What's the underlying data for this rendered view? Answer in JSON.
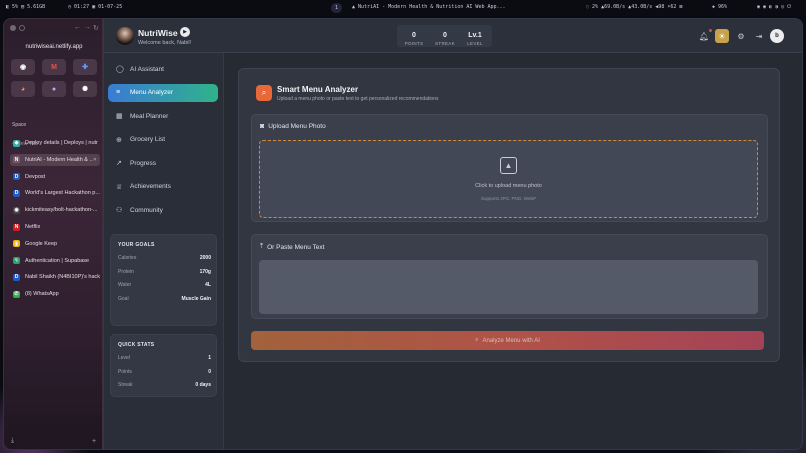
{
  "sysbar": {
    "left_a": "5%",
    "left_b": "5.61GB",
    "clock": "01:27",
    "date": "01-07-25",
    "workspace": "1",
    "window_title": "NutriAI - Modern Health & Nutrition AI Web App...",
    "cpu": "2%",
    "net_down": "69.0B/s",
    "net_up": "43.0B/s",
    "vol": "98",
    "bright": "62",
    "battery": "96%"
  },
  "browser": {
    "url": "nutriwiseai.netlify.app",
    "space_label": "Space",
    "new_tab": "+  New Tab",
    "favorites": [
      {
        "icon": "github-icon",
        "glyph": "◉",
        "color": "#ffffff"
      },
      {
        "icon": "gmail-icon",
        "glyph": "M",
        "color": "#e0574a"
      },
      {
        "icon": "plus-icon",
        "glyph": "✚",
        "color": "#5aa0ff"
      },
      {
        "icon": "colorful-icon",
        "glyph": "◕",
        "color": "#ff8a3d"
      },
      {
        "icon": "orb-icon",
        "glyph": "●",
        "color": "#b6a9ff"
      },
      {
        "icon": "chatgpt-icon",
        "glyph": "✺",
        "color": "#ffffff"
      }
    ],
    "tabs": [
      {
        "label": "Deploy details | Deploys | nutr",
        "icon": "netlify-icon",
        "glyph": "◆",
        "color": "#2fb3a8"
      },
      {
        "label": "NutriAI - Modern Health & ...",
        "icon": "nutriai-icon",
        "glyph": "N",
        "color": "#7a5a6a"
      },
      {
        "label": "Devpost",
        "icon": "devpost-icon",
        "glyph": "D",
        "color": "#1e5ac8"
      },
      {
        "label": "World's Largest Hackathon p...",
        "icon": "devpost-icon",
        "glyph": "D",
        "color": "#1e5ac8"
      },
      {
        "label": "kickmiteasy/bolt-hackathon-...",
        "icon": "github-icon",
        "glyph": "◉",
        "color": "#444444"
      },
      {
        "label": "Netflix",
        "icon": "netflix-icon",
        "glyph": "N",
        "color": "#d12020"
      },
      {
        "label": "Google Keep",
        "icon": "keep-icon",
        "glyph": "▮",
        "color": "#f2b31c"
      },
      {
        "label": "Authentication | Supabase",
        "icon": "supabase-icon",
        "glyph": "ϟ",
        "color": "#2ea06a"
      },
      {
        "label": "Nabil Shaikh (N4BI10P)'s hack...",
        "icon": "devpost-icon",
        "glyph": "D",
        "color": "#1e5ac8"
      },
      {
        "label": "(8) WhatsApp",
        "icon": "whatsapp-icon",
        "glyph": "✆",
        "color": "#2bb04a"
      }
    ]
  },
  "header": {
    "app_name": "NutriWise",
    "welcome": "Welcome back, Nabil!",
    "stats": [
      {
        "value": "0",
        "label": "POINTS"
      },
      {
        "value": "0",
        "label": "STREAK"
      },
      {
        "value": "Lv.1",
        "label": "LEVEL"
      }
    ]
  },
  "nav": {
    "items": [
      {
        "label": "AI Assistant",
        "icon": "chat-icon",
        "glyph": "◯"
      },
      {
        "label": "Menu Analyzer",
        "icon": "menu-lines-icon",
        "glyph": "≡"
      },
      {
        "label": "Meal Planner",
        "icon": "calendar-icon",
        "glyph": "▦"
      },
      {
        "label": "Grocery List",
        "icon": "cart-icon",
        "glyph": "⊕"
      },
      {
        "label": "Progress",
        "icon": "trend-icon",
        "glyph": "↗"
      },
      {
        "label": "Achievements",
        "icon": "trophy-icon",
        "glyph": "♕"
      },
      {
        "label": "Community",
        "icon": "users-icon",
        "glyph": "⚇"
      }
    ]
  },
  "goals": {
    "title": "YOUR GOALS",
    "rows": [
      {
        "label": "Calories",
        "value": "2000"
      },
      {
        "label": "Protein",
        "value": "170g"
      },
      {
        "label": "Water",
        "value": "4L"
      },
      {
        "label": "Goal",
        "value": "Muscle Gain"
      }
    ]
  },
  "quickstats": {
    "title": "QUICK STATS",
    "rows": [
      {
        "label": "Level",
        "value": "1"
      },
      {
        "label": "Points",
        "value": "0"
      },
      {
        "label": "Streak",
        "value": "0 days"
      }
    ]
  },
  "analyzer": {
    "title": "Smart Menu Analyzer",
    "subtitle": "Upload a menu photo or paste text to get personalized recommendations",
    "upload_header": "Upload Menu Photo",
    "upload_prompt": "Click to upload menu photo",
    "upload_support": "Supports JPG, PNG, WebP",
    "paste_header": "Or Paste Menu Text",
    "analyze_label": "Analyze Menu with AI"
  }
}
